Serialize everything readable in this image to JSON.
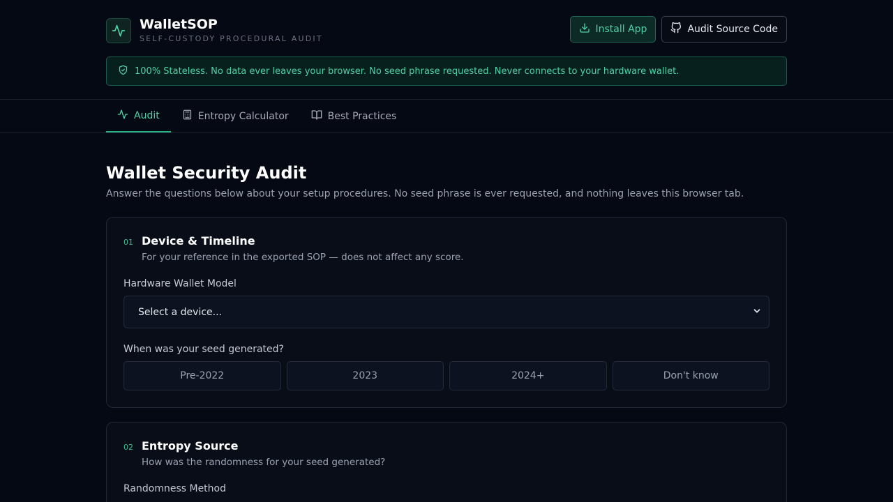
{
  "header": {
    "app_name": "WalletSOP",
    "tagline": "SELF-CUSTODY PROCEDURAL AUDIT",
    "logo_icon": "activity-pulse-icon",
    "install_label": "Install App",
    "source_label": "Audit Source Code"
  },
  "notice": {
    "text": "100% Stateless. No data ever leaves your browser. No seed phrase requested. Never connects to your hardware wallet."
  },
  "tabs": [
    {
      "label": "Audit",
      "icon": "activity-icon",
      "active": true
    },
    {
      "label": "Entropy Calculator",
      "icon": "calculator-icon",
      "active": false
    },
    {
      "label": "Best Practices",
      "icon": "book-open-icon",
      "active": false
    }
  ],
  "main": {
    "title": "Wallet Security Audit",
    "subtitle": "Answer the questions below about your setup procedures. No seed phrase is ever requested, and nothing leaves this browser tab."
  },
  "sections": [
    {
      "num": "01",
      "title": "Device & Timeline",
      "desc": "For your reference in the exported SOP — does not affect any score.",
      "device_label": "Hardware Wallet Model",
      "device_value": "Select a device...",
      "seed_label": "When was your seed generated?",
      "seed_options": [
        "Pre-2022",
        "2023",
        "2024+",
        "Don't know"
      ]
    },
    {
      "num": "02",
      "title": "Entropy Source",
      "desc": "How was the randomness for your seed generated?",
      "method_label": "Randomness Method"
    }
  ],
  "colors": {
    "accent": "#4fd1a5",
    "background": "#050913",
    "card": "#080d18"
  }
}
